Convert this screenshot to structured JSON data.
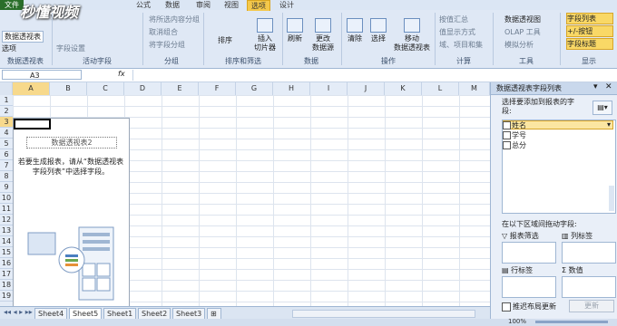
{
  "ribbon": {
    "tabs": [
      "文件",
      "公式",
      "数据",
      "审阅",
      "视图",
      "选项",
      "设计"
    ],
    "active_tab": "选项",
    "context_tab": "设计",
    "pivot_group": {
      "name_label": "数据透视表",
      "options_label": "选项",
      "group_label": "数据透视表"
    },
    "active_field": {
      "field_settings": "字段设置",
      "group_label": "活动字段"
    },
    "group": {
      "expand": "将所选内容分组",
      "ungroup": "取消组合",
      "group_field": "将字段分组",
      "group_label": "分组"
    },
    "sort": {
      "sort_label": "排序",
      "group_label": "排序和筛选",
      "slicer_label": "插入\n切片器"
    },
    "data": {
      "refresh": "刷新",
      "change_source": "更改\n数据源",
      "group_label": "数据"
    },
    "actions": {
      "clear": "清除",
      "select": "选择",
      "move": "移动\n数据透视表",
      "group_label": "操作"
    },
    "calc": {
      "summary": "按值汇总",
      "show_as": "值显示方式",
      "fields_items": "域、项目和集",
      "group_label": "计算"
    },
    "tools": {
      "pivotchart": "数据透视图",
      "olap": "OLAP 工具",
      "whatif": "模拟分析",
      "group_label": "工具"
    },
    "show": {
      "field_list": "字段列表",
      "buttons": "+/-按钮",
      "headers": "字段标题",
      "group_label": "显示"
    }
  },
  "formula_bar": {
    "cell_ref": "A3",
    "fx": "fx",
    "value": ""
  },
  "grid": {
    "columns": [
      "A",
      "B",
      "C",
      "D",
      "E",
      "F",
      "G",
      "H",
      "I",
      "J",
      "K",
      "L",
      "M"
    ],
    "rows": [
      "1",
      "2",
      "3",
      "4",
      "5",
      "6",
      "7",
      "8",
      "9",
      "10",
      "11",
      "12",
      "13",
      "14",
      "15",
      "16",
      "17",
      "18",
      "19"
    ]
  },
  "pivot_placeholder": {
    "title": "数据透视表2",
    "instructions": "若要生成报表，请从“数据透视表字段列表”中选择字段。"
  },
  "sheets": {
    "tabs": [
      "Sheet4",
      "Sheet5",
      "Sheet1",
      "Sheet2",
      "Sheet3"
    ],
    "active": "Sheet5"
  },
  "field_list": {
    "title": "数据透视表字段列表",
    "prompt": "选择要添加到报表的字段:",
    "fields": [
      "姓名",
      "学号",
      "总分"
    ],
    "areas_prompt": "在以下区域间拖动字段:",
    "report_filter": "报表筛选",
    "column_labels": "列标签",
    "row_labels": "行标签",
    "values": "数值",
    "defer_update": "推迟布局更新",
    "update_button": "更新"
  },
  "status": {
    "zoom": "100%"
  },
  "watermark": "秒懂视频"
}
